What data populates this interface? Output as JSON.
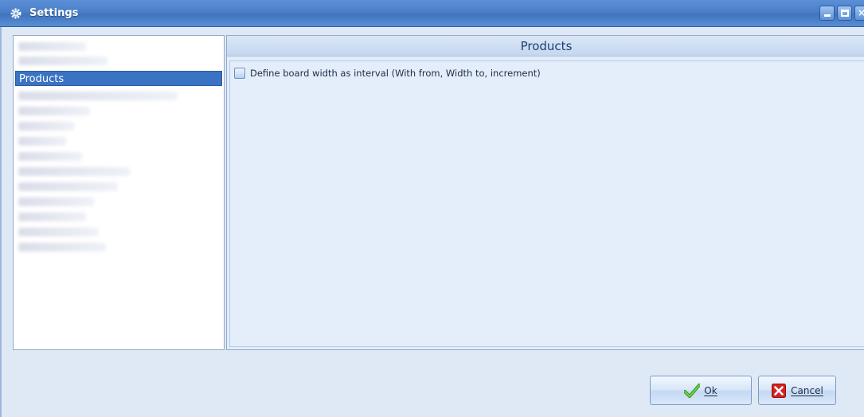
{
  "window": {
    "title": "Settings",
    "icon": "gear-icon",
    "controls": [
      "minimize",
      "maximize",
      "close"
    ]
  },
  "nav": {
    "selected_label": "Products",
    "items_blurred_count_note": ""
  },
  "content": {
    "header": "Products",
    "option_label": "Define board width as interval (With from, Width to, increment)",
    "option_checked": false
  },
  "buttons": {
    "ok_label": "Ok",
    "cancel_label": "Cancel"
  },
  "colors": {
    "titlebar": "#4b7fc9",
    "selection": "#3a73c4",
    "header_text": "#1c3f77",
    "ok_icon": "#3fae2a",
    "cancel_icon": "#d62020"
  }
}
